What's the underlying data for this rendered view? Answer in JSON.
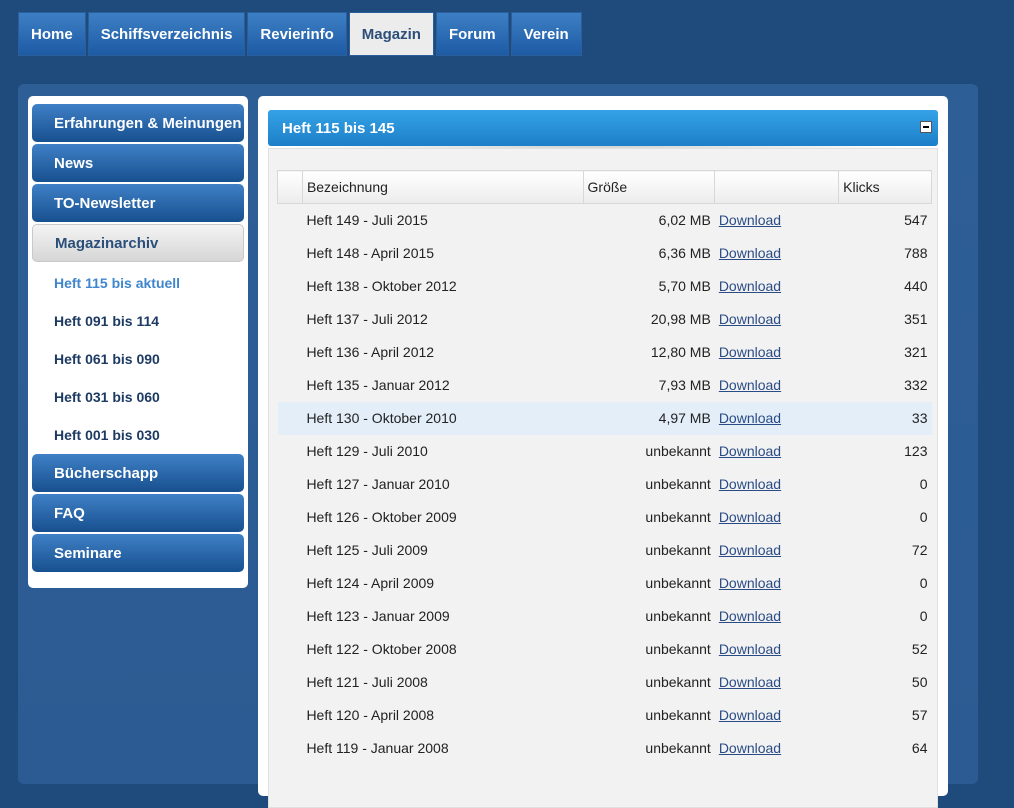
{
  "topnav": {
    "tabs": [
      {
        "label": "Home"
      },
      {
        "label": "Schiffsverzeichnis"
      },
      {
        "label": "Revierinfo"
      },
      {
        "label": "Magazin",
        "active": true
      },
      {
        "label": "Forum"
      },
      {
        "label": "Verein"
      }
    ]
  },
  "sidebar": {
    "items": [
      {
        "label": "Erfahrungen & Meinungen"
      },
      {
        "label": "News"
      },
      {
        "label": "TO-Newsletter"
      },
      {
        "label": "Magazinarchiv"
      },
      {
        "label": "Heft 115 bis aktuell"
      },
      {
        "label": "Heft 091 bis 114"
      },
      {
        "label": "Heft 061 bis 090"
      },
      {
        "label": "Heft 031 bis 060"
      },
      {
        "label": "Heft 001 bis 030"
      },
      {
        "label": "Bücherschapp"
      },
      {
        "label": "FAQ"
      },
      {
        "label": "Seminare"
      }
    ]
  },
  "panel": {
    "title": "Heft 115 bis 145",
    "columns": {
      "name": "Bezeichnung",
      "size": "Größe",
      "download": "",
      "clicks": "Klicks"
    },
    "download_label": "Download",
    "rows": [
      {
        "name": "Heft 149 - Juli 2015",
        "size": "6,02 MB",
        "clicks": "547"
      },
      {
        "name": "Heft 148 - April 2015",
        "size": "6,36 MB",
        "clicks": "788"
      },
      {
        "name": "Heft 138 - Oktober 2012",
        "size": "5,70 MB",
        "clicks": "440"
      },
      {
        "name": "Heft 137 - Juli 2012",
        "size": "20,98 MB",
        "clicks": "351"
      },
      {
        "name": "Heft 136 - April 2012",
        "size": "12,80 MB",
        "clicks": "321"
      },
      {
        "name": "Heft 135 - Januar 2012",
        "size": "7,93 MB",
        "clicks": "332"
      },
      {
        "name": "Heft 130 - Oktober 2010",
        "size": "4,97 MB",
        "clicks": "33"
      },
      {
        "name": "Heft 129 - Juli 2010",
        "size": "unbekannt",
        "clicks": "123"
      },
      {
        "name": "Heft 127 - Januar 2010",
        "size": "unbekannt",
        "clicks": "0"
      },
      {
        "name": "Heft 126 - Oktober 2009",
        "size": "unbekannt",
        "clicks": "0"
      },
      {
        "name": "Heft 125 - Juli 2009",
        "size": "unbekannt",
        "clicks": "72"
      },
      {
        "name": "Heft 124 - April 2009",
        "size": "unbekannt",
        "clicks": "0"
      },
      {
        "name": "Heft 123 - Januar 2009",
        "size": "unbekannt",
        "clicks": "0"
      },
      {
        "name": "Heft 122 - Oktober 2008",
        "size": "unbekannt",
        "clicks": "52"
      },
      {
        "name": "Heft 121 - Juli 2008",
        "size": "unbekannt",
        "clicks": "50"
      },
      {
        "name": "Heft 120 - April 2008",
        "size": "unbekannt",
        "clicks": "57"
      },
      {
        "name": "Heft 119 - Januar 2008",
        "size": "unbekannt",
        "clicks": "64"
      }
    ]
  },
  "colors": {
    "accent": "#1d7fc8",
    "nav": "#1d5ba5",
    "background": "#1f4a7c",
    "link": "#2a4c86"
  }
}
